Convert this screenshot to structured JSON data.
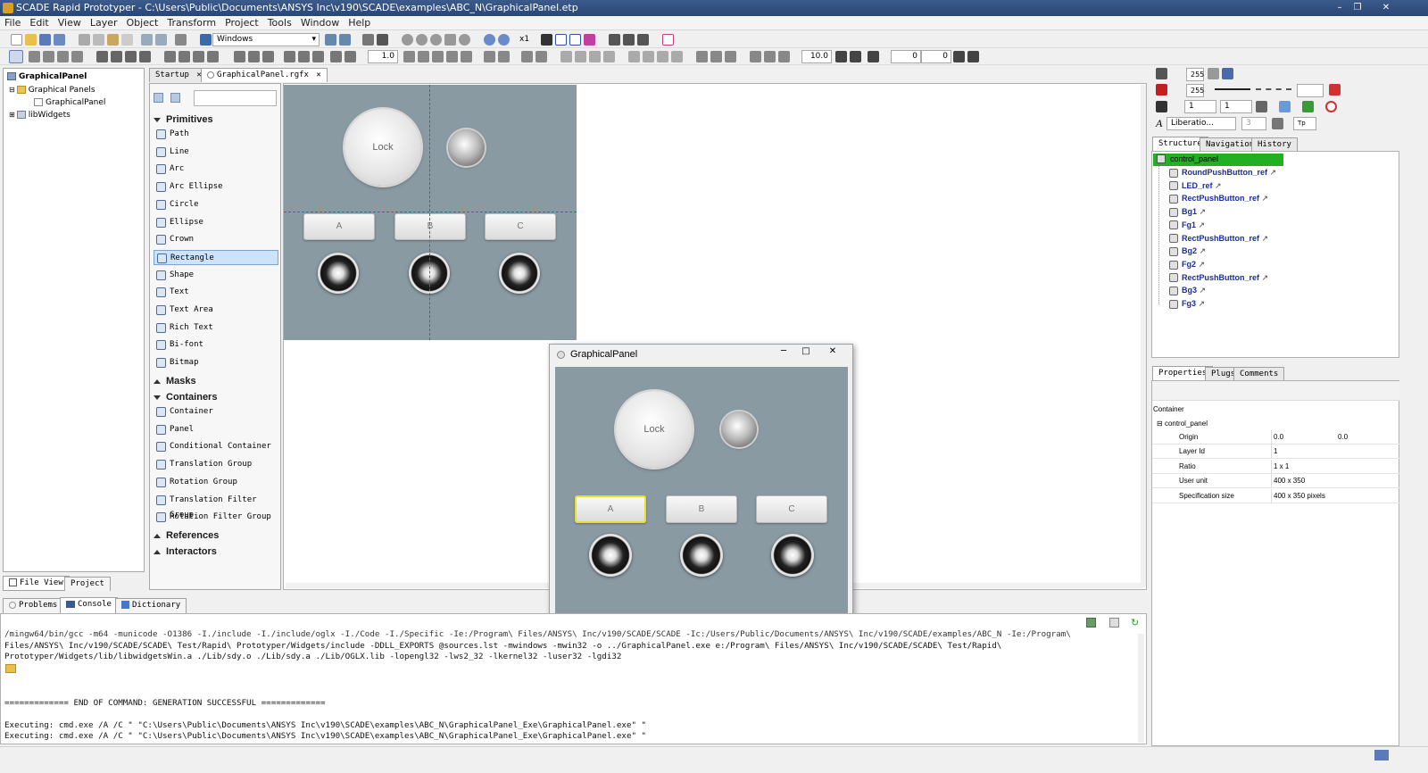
{
  "window": {
    "title": "SCADE Rapid Prototyper - C:\\Users\\Public\\Documents\\ANSYS Inc\\v190\\SCADE\\examples\\ABC_N\\GraphicalPanel.etp"
  },
  "menu": [
    "File",
    "Edit",
    "View",
    "Layer",
    "Object",
    "Transform",
    "Project",
    "Tools",
    "Window",
    "Help"
  ],
  "toolbar": {
    "platform_select": "Windows",
    "zoom_label": "x1",
    "line_width": "1.0",
    "grid_size": "10.0",
    "offset_x": "0",
    "offset_y": "0"
  },
  "file_tree": {
    "root": "GraphicalPanel",
    "items": [
      {
        "label": "Graphical Panels"
      },
      {
        "label": "GraphicalPanel"
      },
      {
        "label": "libWidgets"
      }
    ]
  },
  "left_tabs": {
    "file_view": "File View",
    "project": "Project"
  },
  "editor_tabs": [
    {
      "label": "Startup"
    },
    {
      "label": "GraphicalPanel.rgfx"
    }
  ],
  "palette": {
    "primitives_header": "Primitives",
    "primitives": [
      "Path",
      "Line",
      "Arc",
      "Arc Ellipse",
      "Circle",
      "Ellipse",
      "Crown",
      "Rectangle",
      "Shape",
      "Text",
      "Text Area",
      "Rich Text",
      "Bi-font",
      "Bitmap"
    ],
    "masks_header": "Masks",
    "containers_header": "Containers",
    "containers": [
      "Container",
      "Panel",
      "Conditional Container",
      "Translation Group",
      "Rotation Group",
      "Translation Filter Group",
      "Rotation Filter Group"
    ],
    "references_header": "References",
    "interactors_header": "Interactors"
  },
  "design_canvas": {
    "lock_label": "Lock",
    "buttons": [
      "A",
      "B",
      "C"
    ]
  },
  "preview_window": {
    "title": "GraphicalPanel",
    "lock_label": "Lock",
    "buttons": [
      "A",
      "B",
      "C"
    ]
  },
  "bottom_tabs": [
    "Problems",
    "Console",
    "Dictionary"
  ],
  "console": {
    "lines": [
      "/mingw64/bin/gcc -m64 -municode -O1386 -I./include -I./include/oglx -I./Code -I./Specific -Ie:/Program\\ Files/ANSYS\\ Inc/v190/SCADE/SCADE -Ic:/Users/Public/Documents/ANSYS\\ Inc/v190/SCADE/examples/ABC_N -Ie:/Program\\",
      "Files/ANSYS\\ Inc/v190/SCADE/SCADE\\ Test/Rapid\\ Prototyper/Widgets/include -DDLL_EXPORTS @sources.lst -mwindows -mwin32 -o ../GraphicalPanel.exe e:/Program\\ Files/ANSYS\\ Inc/v190/SCADE/SCADE\\ Test/Rapid\\",
      "Prototyper/Widgets/lib/libwidgetsWin.a ./Lib/sdy.o ./Lib/sdy.a ./Lib/OGLX.lib -lopengl32 -lws2_32 -lkernel32 -luser32 -lgdi32",
      "============= END OF COMMAND: GENERATION SUCCESSFUL =============",
      "Executing: cmd.exe /A /C \" \"C:\\Users\\Public\\Documents\\ANSYS Inc\\v190\\SCADE\\examples\\ABC_N\\GraphicalPanel_Exe\\GraphicalPanel.exe\" \"",
      "Executing: cmd.exe /A /C \" \"C:\\Users\\Public\\Documents\\ANSYS Inc\\v190\\SCADE\\examples\\ABC_N\\GraphicalPanel_Exe\\GraphicalPanel.exe\" \""
    ]
  },
  "right_toolbar": {
    "alpha1": "255",
    "alpha2": "255",
    "width1": "1",
    "width2": "1",
    "font": "Liberatio...",
    "font_size": "3",
    "tp": "Tp"
  },
  "structure_tabs": [
    "Structure",
    "Navigation",
    "History"
  ],
  "structure": {
    "root": "control_panel",
    "items": [
      "RoundPushButton_ref",
      "LED_ref",
      "RectPushButton_ref",
      "Bg1",
      "Fg1",
      "RectPushButton_ref",
      "Bg2",
      "Fg2",
      "RectPushButton_ref",
      "Bg3",
      "Fg3"
    ]
  },
  "properties_tabs": [
    "Properties",
    "Plugs",
    "Comments"
  ],
  "properties": {
    "section": "Container",
    "node": "control_panel",
    "rows": [
      {
        "key": "Origin",
        "value": "0.0",
        "value2": "0.0"
      },
      {
        "key": "Layer Id",
        "value": "1",
        "value2": ""
      },
      {
        "key": "Ratio",
        "value": "1 x 1",
        "value2": ""
      },
      {
        "key": "User unit",
        "value": "400 x 350",
        "value2": ""
      },
      {
        "key": "Specification size",
        "value": "400 x 350 pixels",
        "value2": ""
      }
    ]
  },
  "colors": {
    "selection_green": "#22b022",
    "canvas": "#8a9aa2",
    "guide": "#d83030",
    "focus_yellow": "#e8e030"
  }
}
